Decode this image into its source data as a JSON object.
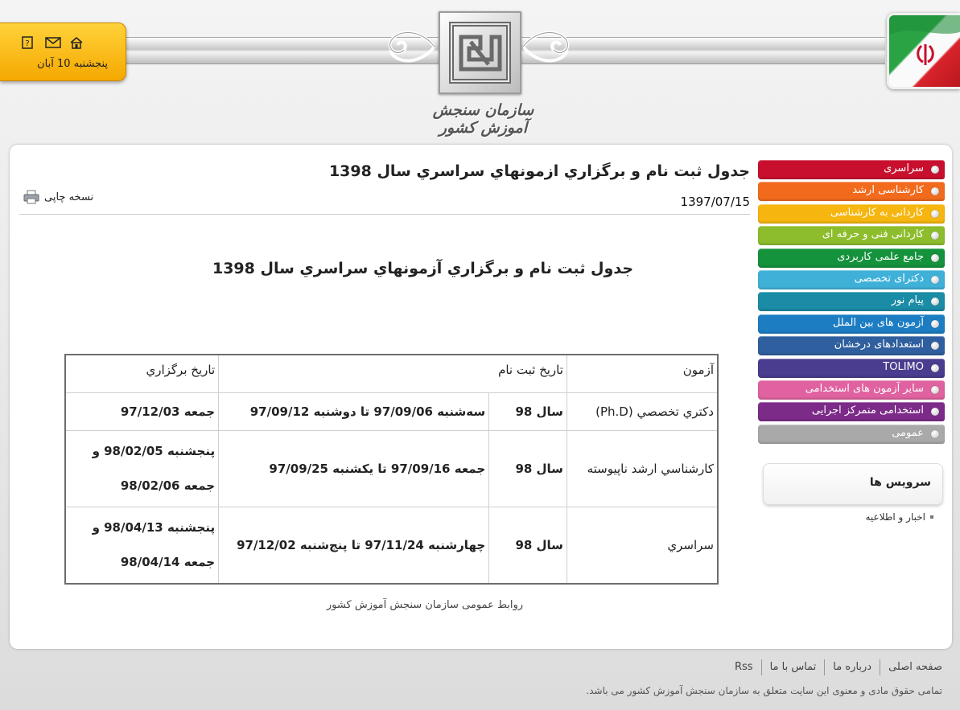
{
  "header": {
    "date": "پنجشنبه 10 آبان",
    "logo_caption": "سازمان سنجش آموزش کشور",
    "icons": [
      "help-icon",
      "mail-icon",
      "home-icon"
    ]
  },
  "article": {
    "title": "جدول ثبت نام و برگزاري ازمونهاي سراسري سال 1398",
    "date": "1397/07/15",
    "print_label": "نسخه چاپی",
    "heading": "جدول ثبت نام و برگزاري آزمونهاي سراسري سال 1398",
    "table": {
      "headers": {
        "exam": "آزمون",
        "registration": "تاريخ ثبت نام",
        "held": "تاريخ برگزاري"
      },
      "rows": [
        {
          "exam": "دكتري تخصصي (Ph.D)",
          "year": "سال 98",
          "registration": "سه‌شنبه 97/09/06 تا دوشنبه 97/09/12",
          "held": [
            "جمعه 97/12/03"
          ]
        },
        {
          "exam": "كارشناسي ارشد ناپيوسته",
          "year": "سال 98",
          "registration": "جمعه 97/09/16 تا يكشنبه 97/09/25",
          "held": [
            "پنجشنبه 98/02/05 و",
            "جمعه 98/02/06"
          ]
        },
        {
          "exam": "سراسري",
          "year": "سال 98",
          "registration": "چهارشنبه 97/11/24 تا پنج‌شنبه 97/12/02",
          "held": [
            "پنجشنبه 98/04/13 و",
            "جمعه 98/04/14"
          ]
        }
      ]
    },
    "footer_note": "روابط عمومی سازمان سنجش آموزش کشور"
  },
  "sidebar": {
    "menu": [
      {
        "label": "سراسری",
        "color": "#c8102e"
      },
      {
        "label": "کارشناسی ارشد",
        "color": "#f26b1d"
      },
      {
        "label": "کاردانی به کارشناسی",
        "color": "#f6b60f"
      },
      {
        "label": "کاردانی فنی و حرفه ای",
        "color": "#8dbd2c"
      },
      {
        "label": "جامع علمی کاربردی",
        "color": "#14923c"
      },
      {
        "label": "دکترای تخصصی",
        "color": "#3fb1d8"
      },
      {
        "label": "پیام نور",
        "color": "#1a8ca6"
      },
      {
        "label": "آزمون های بین الملل",
        "color": "#1c7dc3"
      },
      {
        "label": "استعدادهای درخشان",
        "color": "#2f5f9e"
      },
      {
        "label": "TOLIMO",
        "color": "#4a3c8e"
      },
      {
        "label": "سایر آزمون های استخدامی",
        "color": "#e062a0"
      },
      {
        "label": "استخدامی متمرکز اجرایی",
        "color": "#7c2b88"
      },
      {
        "label": "عمومی",
        "color": "#a9a9a9"
      }
    ],
    "services_title": "سرویس ها",
    "news_link": "اخبار و اطلاعیه"
  },
  "footer": {
    "links": [
      "صفحه اصلی",
      "درباره ما",
      "تماس با ما",
      "Rss"
    ],
    "copyright": "تمامی حقوق مادی و معنوی این سایت متعلق به سازمان سنجش آموزش کشور می باشد."
  }
}
